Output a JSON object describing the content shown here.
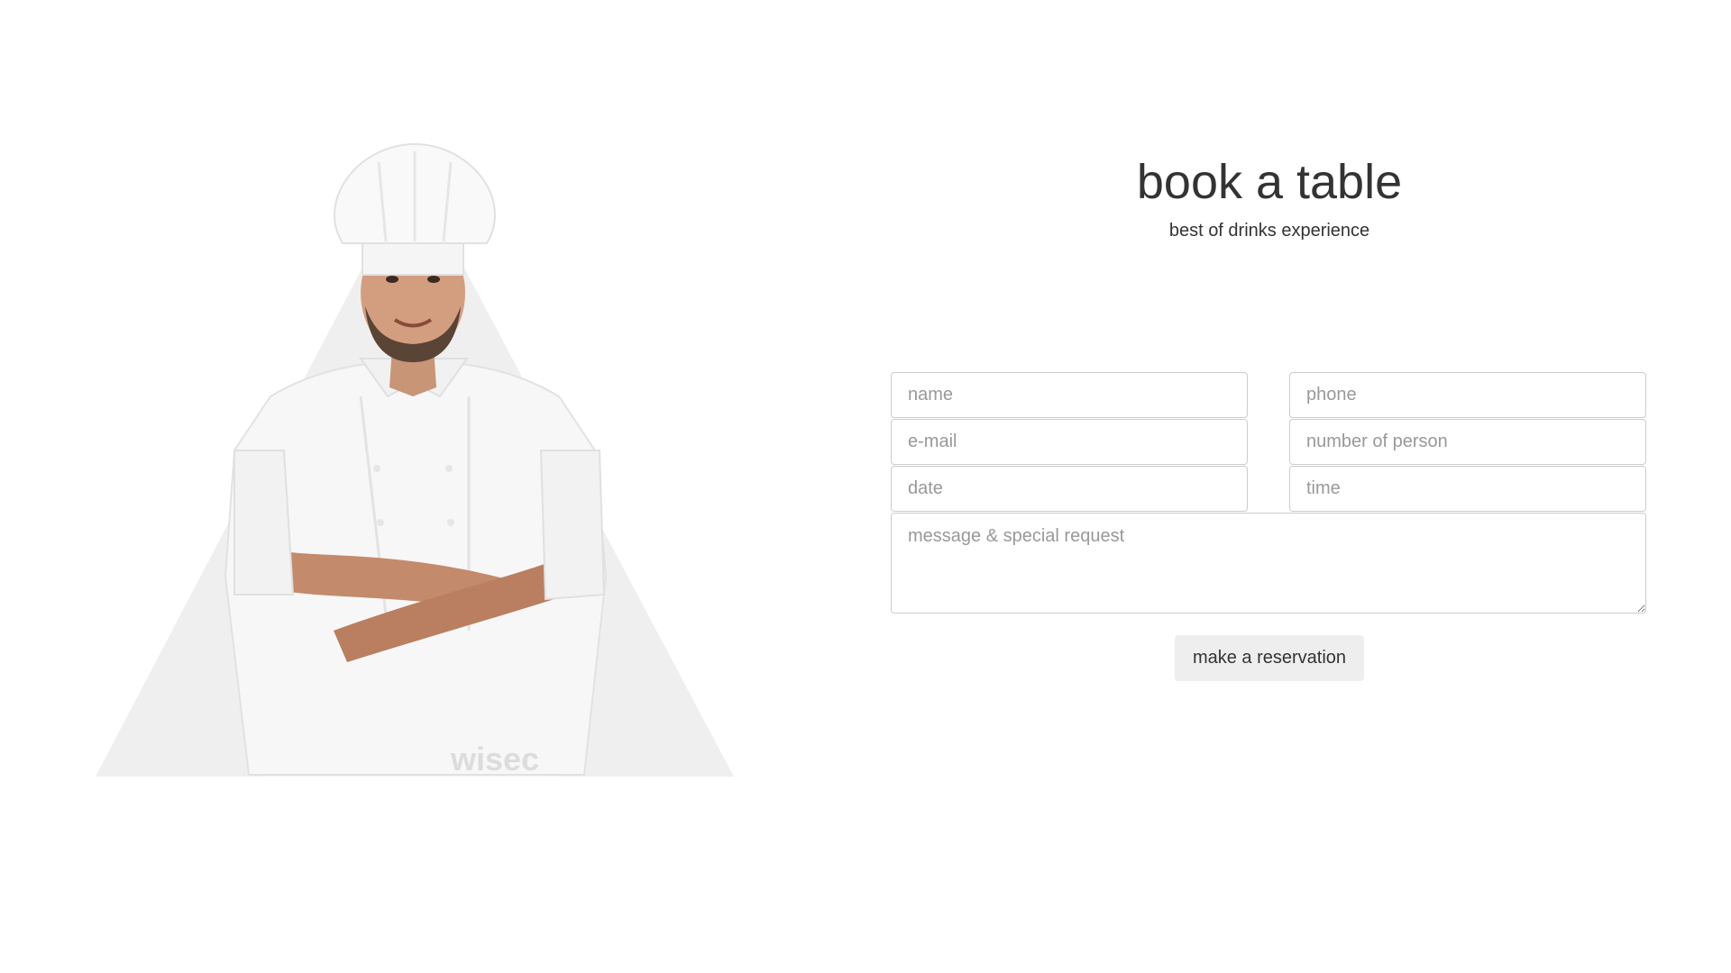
{
  "booking": {
    "title": "book a table",
    "subtitle": "best of drinks experience",
    "fields": {
      "name_placeholder": "name",
      "phone_placeholder": "phone",
      "email_placeholder": "e-mail",
      "persons_placeholder": "number of person",
      "date_placeholder": "date",
      "time_placeholder": "time",
      "message_placeholder": "message & special request"
    },
    "submit_label": "make a reservation"
  },
  "hero": {
    "image": "chef-photo",
    "watermark": "wisec"
  },
  "colors": {
    "triangle": "#eeeeee",
    "button_bg": "#eeeeee",
    "text": "#333333",
    "placeholder": "#999999",
    "border": "#cccccc"
  }
}
